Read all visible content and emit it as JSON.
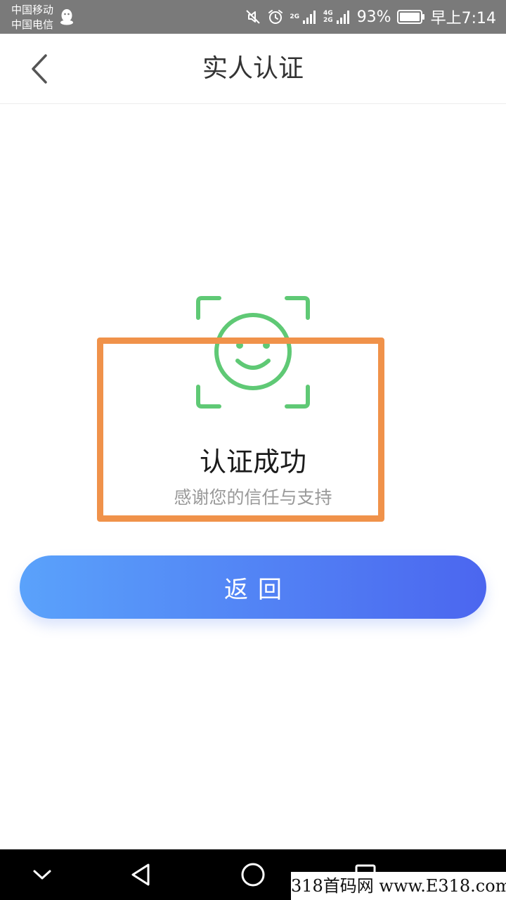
{
  "status_bar": {
    "carrier_1": "中国移动",
    "carrier_2": "中国电信",
    "network_1": "2G",
    "network_2a": "4G",
    "network_2b": "2G",
    "battery_percent": "93%",
    "time": "早上7:14",
    "icons": [
      "qq-icon",
      "mute-icon",
      "alarm-icon",
      "signal-icon",
      "battery-icon"
    ]
  },
  "header": {
    "title": "实人认证",
    "back_icon": "chevron-left-icon"
  },
  "result": {
    "icon": "smiley-face-scan-icon",
    "title": "认证成功",
    "subtitle": "感谢您的信任与支持"
  },
  "actions": {
    "return_label": "返回"
  },
  "nav_bar": {
    "icons": [
      "chevron-down-icon",
      "nav-back-icon",
      "nav-home-icon",
      "nav-recent-icon"
    ]
  },
  "watermark": {
    "text": "318首码网 www.E318.com"
  },
  "colors": {
    "status_bar": "#7a7a7a",
    "success_green": "#5fc975",
    "highlight_orange": "#f0924a",
    "button_gradient_start": "#5aa2fb",
    "button_gradient_end": "#4b66ef",
    "nav_bar": "#000000"
  }
}
